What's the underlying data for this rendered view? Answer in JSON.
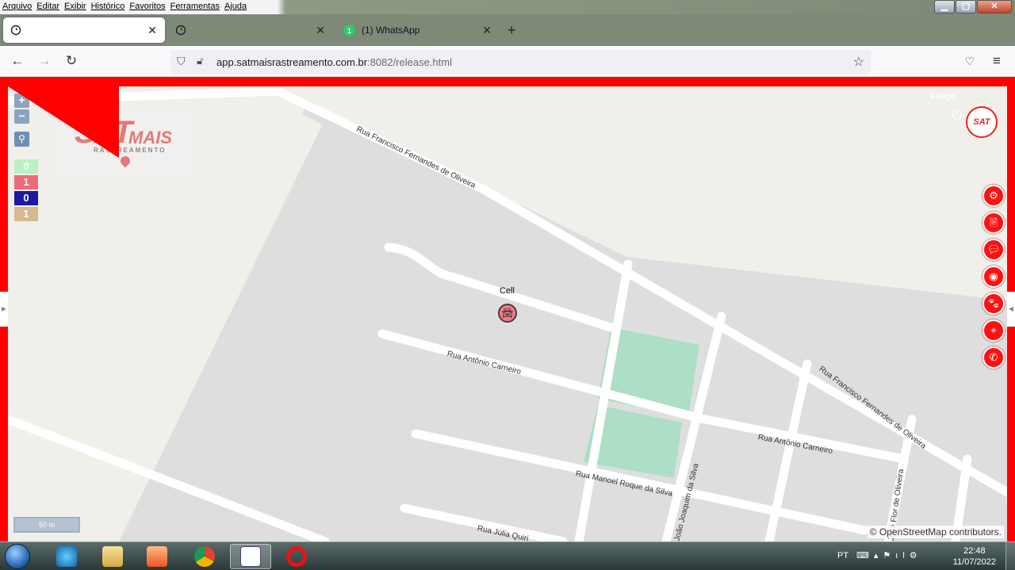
{
  "menubar": {
    "items": [
      "Arquivo",
      "Editar",
      "Exibir",
      "Histórico",
      "Favoritos",
      "Ferramentas",
      "Ajuda"
    ]
  },
  "tabs": [
    {
      "label": "",
      "icon": "globe-icon",
      "active": true
    },
    {
      "label": "",
      "icon": "globe-icon",
      "active": false
    },
    {
      "label": "(1) WhatsApp",
      "icon": "whatsapp-icon",
      "badge": "1",
      "active": false
    }
  ],
  "navbar": {
    "url_domain": "app.satmaisrastreamento.com.br",
    "url_path": ":8082/release.html"
  },
  "map": {
    "zoom_in": "+",
    "zoom_out": "−",
    "counters": [
      {
        "value": "0",
        "color": "#b9f1c4"
      },
      {
        "value": "1",
        "color": "#f06a78"
      },
      {
        "value": "0",
        "color": "#1c1aa4"
      },
      {
        "value": "1",
        "color": "#d9b88f"
      }
    ],
    "logo": {
      "main": "SAT",
      "sub": "MAIS",
      "tagline": "RASTREAMENTO"
    },
    "vehicle_label": "Cell",
    "streets": [
      "Rua Francisco Fernandes de Oliveira",
      "Rua Antônio Carneiro",
      "Rua Francisco Fernandes de Oliveira",
      "Rua Antônio Carneiro",
      "Rua Manoel Roque da Silva",
      "João Joaquim da Silva",
      "José Flor de Oliveira",
      "Rua Júlia Quiri"
    ],
    "scale": "50 m",
    "attribution": "© OpenStreetMap contributors."
  },
  "header": {
    "user": "Felipe",
    "brand": "SAT"
  },
  "side_buttons": [
    {
      "name": "settings-button",
      "icon": "gears-icon"
    },
    {
      "name": "report-button",
      "icon": "document-icon"
    },
    {
      "name": "messages-button",
      "icon": "chat-icon"
    },
    {
      "name": "target-button",
      "icon": "target-icon"
    },
    {
      "name": "paw-button",
      "icon": "paw-icon"
    },
    {
      "name": "locate-button",
      "icon": "crosshair-icon"
    },
    {
      "name": "whatsapp-button",
      "icon": "whatsapp-icon"
    }
  ],
  "taskbar": {
    "lang": "PT",
    "time": "22:48",
    "date": "11/07/2022"
  }
}
